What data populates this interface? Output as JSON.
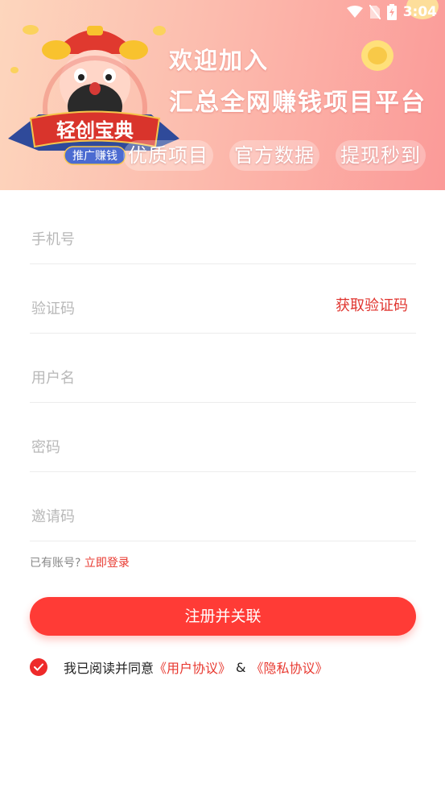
{
  "status_bar": {
    "time": "3:04",
    "icons": [
      "wifi-icon",
      "no-sim-icon",
      "battery-charging-icon"
    ]
  },
  "banner": {
    "logo_title": "轻创宝典",
    "logo_subtitle": "推广赚钱",
    "headline_line1": "欢迎加入",
    "headline_line2": "汇总全网赚钱项目平台",
    "tags": [
      "优质项目",
      "官方数据",
      "提现秒到"
    ],
    "colors": {
      "gradient_start": "#fdd6bd",
      "gradient_end": "#fb9a98"
    }
  },
  "form": {
    "phone_placeholder": "手机号",
    "code_placeholder": "验证码",
    "get_code_label": "获取验证码",
    "username_placeholder": "用户名",
    "password_placeholder": "密码",
    "invite_placeholder": "邀请码"
  },
  "login": {
    "prompt": "已有账号?",
    "link": "立即登录"
  },
  "submit_label": "注册并关联",
  "agreement": {
    "checked": true,
    "text": "我已阅读并同意",
    "user_agreement": "《用户协议》",
    "amp": "&",
    "privacy_agreement": "《隐私协议》"
  },
  "accent_color": "#ff3b36"
}
